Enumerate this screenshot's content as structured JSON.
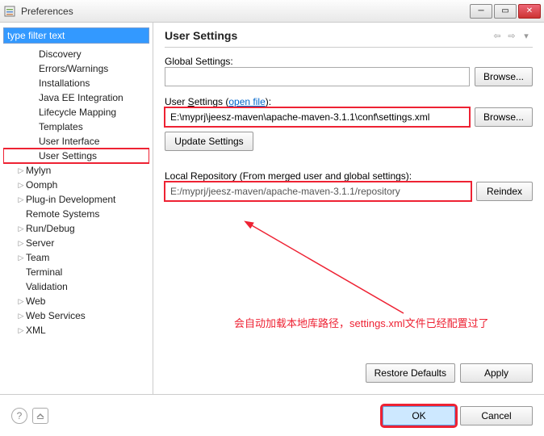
{
  "window": {
    "title": "Preferences"
  },
  "filter": {
    "value": "type filter text"
  },
  "tree": {
    "items": [
      {
        "indent": 2,
        "exp": "",
        "label": "Discovery",
        "hl": false
      },
      {
        "indent": 2,
        "exp": "",
        "label": "Errors/Warnings",
        "hl": false
      },
      {
        "indent": 2,
        "exp": "",
        "label": "Installations",
        "hl": false
      },
      {
        "indent": 2,
        "exp": "",
        "label": "Java EE Integration",
        "hl": false
      },
      {
        "indent": 2,
        "exp": "",
        "label": "Lifecycle Mapping",
        "hl": false
      },
      {
        "indent": 2,
        "exp": "",
        "label": "Templates",
        "hl": false
      },
      {
        "indent": 2,
        "exp": "",
        "label": "User Interface",
        "hl": false
      },
      {
        "indent": 2,
        "exp": "",
        "label": "User Settings",
        "hl": true
      },
      {
        "indent": 1,
        "exp": "▷",
        "label": "Mylyn",
        "hl": false
      },
      {
        "indent": 1,
        "exp": "▷",
        "label": "Oomph",
        "hl": false
      },
      {
        "indent": 1,
        "exp": "▷",
        "label": "Plug-in Development",
        "hl": false
      },
      {
        "indent": 1,
        "exp": "",
        "label": "Remote Systems",
        "hl": false
      },
      {
        "indent": 1,
        "exp": "▷",
        "label": "Run/Debug",
        "hl": false
      },
      {
        "indent": 1,
        "exp": "▷",
        "label": "Server",
        "hl": false
      },
      {
        "indent": 1,
        "exp": "▷",
        "label": "Team",
        "hl": false
      },
      {
        "indent": 1,
        "exp": "",
        "label": "Terminal",
        "hl": false
      },
      {
        "indent": 1,
        "exp": "",
        "label": "Validation",
        "hl": false
      },
      {
        "indent": 1,
        "exp": "▷",
        "label": "Web",
        "hl": false
      },
      {
        "indent": 1,
        "exp": "▷",
        "label": "Web Services",
        "hl": false
      },
      {
        "indent": 1,
        "exp": "▷",
        "label": "XML",
        "hl": false
      }
    ]
  },
  "main": {
    "title": "User Settings",
    "global_label": "Global Settings:",
    "global_value": "",
    "browse1": "Browse...",
    "user_label_pre": "User ",
    "user_label_u": "S",
    "user_label_post": "ettings (",
    "open_file": "open file",
    "user_label_end": "):",
    "user_value": "E:\\myprj\\jeesz-maven\\apache-maven-3.1.1\\conf\\settings.xml",
    "browse2": "Browse...",
    "update": "Update Settings",
    "repo_label": "Local Repository (From merged user and global settings):",
    "repo_value": "E:/myprj/jeesz-maven/apache-maven-3.1.1/repository",
    "reindex": "Reindex",
    "annotation": "会自动加载本地库路径，settings.xml文件已经配置过了",
    "restore": "Restore Defaults",
    "apply": "Apply"
  },
  "footer": {
    "ok": "OK",
    "cancel": "Cancel"
  }
}
